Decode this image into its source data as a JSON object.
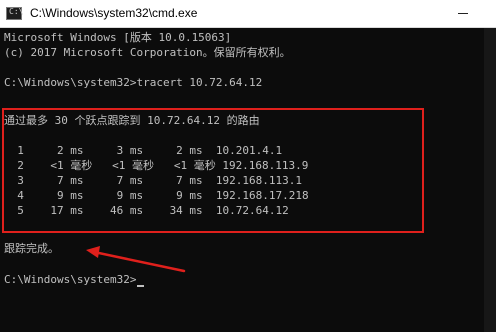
{
  "window": {
    "title": "C:\\Windows\\system32\\cmd.exe",
    "icon": "console-icon"
  },
  "console": {
    "banner_line1": "Microsoft Windows [版本 10.0.15063]",
    "banner_line2": "(c) 2017 Microsoft Corporation。保留所有权利。",
    "command_line": "C:\\Windows\\system32>tracert 10.72.64.12",
    "trace_header": "通过最多 30 个跃点跟踪到 10.72.64.12 的路由",
    "hops": [
      "  1     2 ms     3 ms     2 ms  10.201.4.1",
      "  2    <1 毫秒   <1 毫秒   <1 毫秒 192.168.113.9",
      "  3     7 ms     7 ms     7 ms  192.168.113.1",
      "  4     9 ms     9 ms     9 ms  192.168.17.218",
      "  5    17 ms    46 ms    34 ms  10.72.64.12"
    ],
    "complete_text": "跟踪完成。",
    "final_prompt": "C:\\Windows\\system32>"
  },
  "annotation": {
    "highlight_color": "#e0201c"
  }
}
